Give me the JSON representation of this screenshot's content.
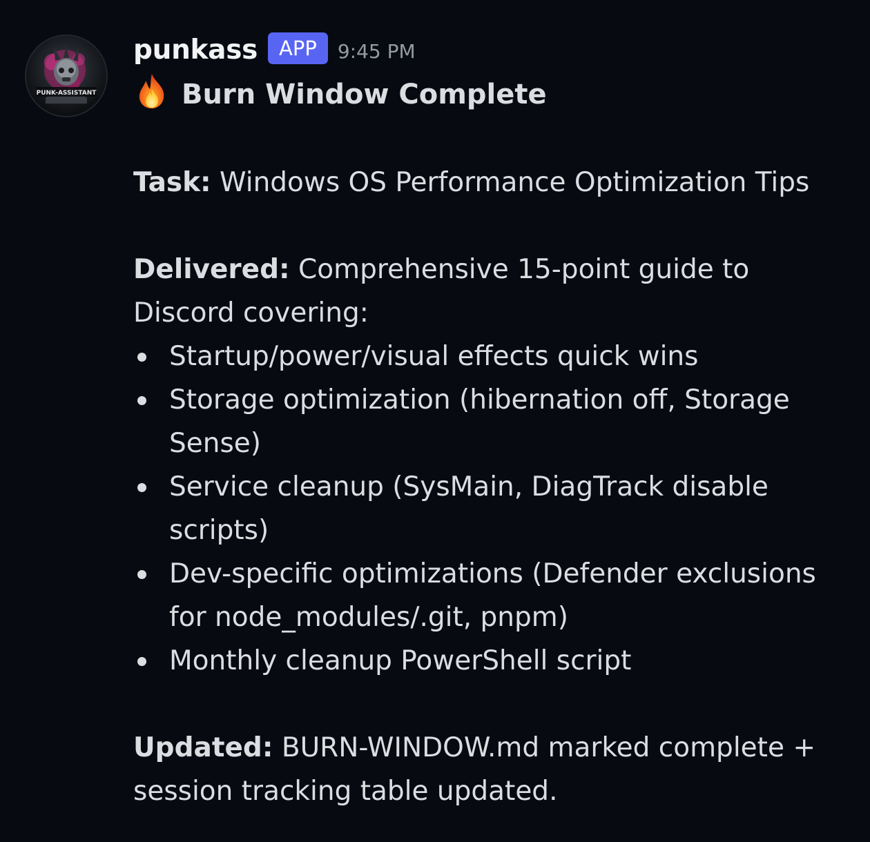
{
  "message": {
    "author": "punkass",
    "badge": "APP",
    "timestamp": "9:45 PM",
    "avatar": {
      "icon": "punk-assistant-avatar",
      "caption": "PUNK-ASSISTANT"
    },
    "title": {
      "icon": "fire-emoji",
      "text": "Burn Window Complete"
    },
    "task": {
      "label": "Task:",
      "text": "Windows OS Performance Optimization Tips"
    },
    "delivered": {
      "label": "Delivered:",
      "text": "Comprehensive 15-point guide to Discord covering:",
      "items": [
        "Startup/power/visual effects quick wins",
        "Storage optimization (hibernation off, Storage Sense)",
        "Service cleanup (SysMain, DiagTrack disable scripts)",
        "Dev-specific optimizations (Defender exclusions for node_modules/.git, pnpm)",
        "Monthly cleanup PowerShell script"
      ]
    },
    "updated": {
      "label": "Updated:",
      "text": "BURN-WINDOW.md marked complete + session tracking table updated."
    }
  },
  "colors": {
    "background": "#070b11",
    "text": "#dbdee1",
    "username": "#f2f3f5",
    "timestamp": "#949ba4",
    "app_badge": "#5865f2"
  }
}
